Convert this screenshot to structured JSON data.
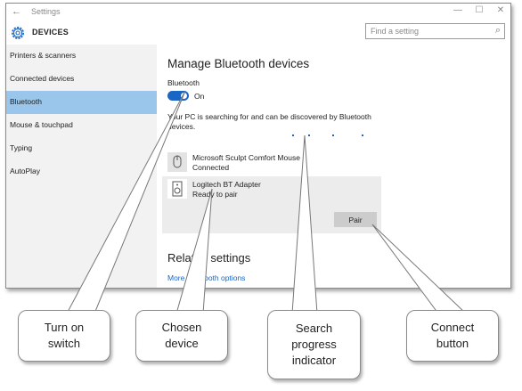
{
  "window": {
    "title": "Settings",
    "back_glyph": "←",
    "controls": [
      "—",
      "☐",
      "✕"
    ]
  },
  "header": {
    "app_title": "DEVICES",
    "search_placeholder": "Find a setting"
  },
  "sidebar": {
    "items": [
      {
        "label": "Printers & scanners"
      },
      {
        "label": "Connected devices"
      },
      {
        "label": "Bluetooth",
        "active": true
      },
      {
        "label": "Mouse & touchpad"
      },
      {
        "label": "Typing"
      },
      {
        "label": "AutoPlay"
      }
    ]
  },
  "main": {
    "title": "Manage Bluetooth devices",
    "bluetooth_label": "Bluetooth",
    "toggle_state": "On",
    "description": "Your PC is searching for and can be discovered by Bluetooth devices.",
    "devices": [
      {
        "name": "Microsoft Sculpt Comfort Mouse",
        "status": "Connected",
        "icon": "mouse-icon"
      },
      {
        "name": "Logitech BT Adapter",
        "status": "Ready to pair",
        "icon": "speaker-icon"
      }
    ],
    "pair_button": "Pair",
    "related_title": "Related settings",
    "related_link": "More Bluetooth options"
  },
  "callouts": [
    {
      "line1": "Turn on",
      "line2": "switch"
    },
    {
      "line1": "Chosen",
      "line2": "device"
    },
    {
      "line1": "Search",
      "line2": "progress",
      "line3": "indicator"
    },
    {
      "line1": "Connect",
      "line2": "button"
    }
  ],
  "colors": {
    "accent": "#1a66c4",
    "sidebar_active": "#99c6ea",
    "sidebar_bg": "#f2f2f2",
    "selected_device_bg": "#ececec",
    "pair_button_bg": "#cccccc"
  }
}
